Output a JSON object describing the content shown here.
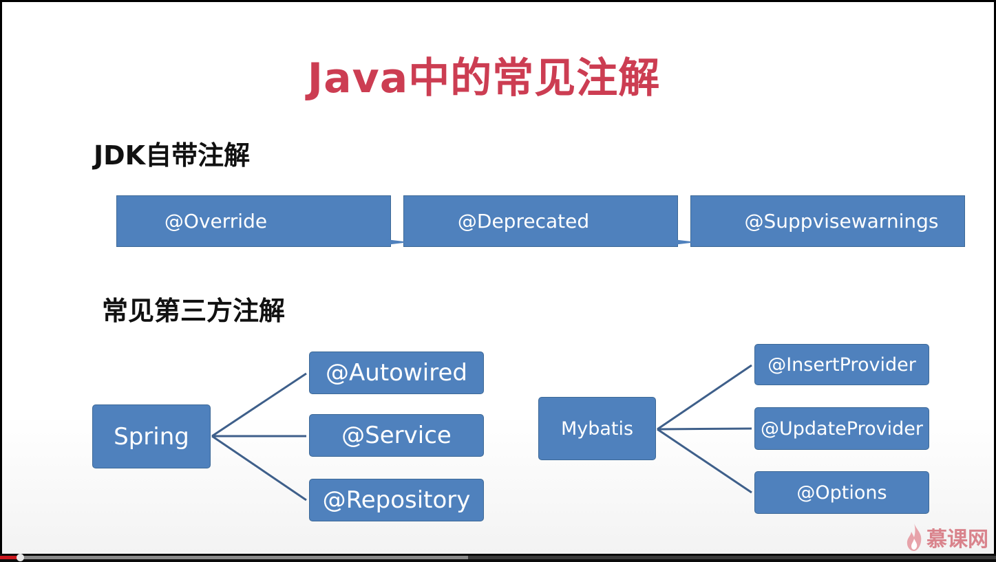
{
  "slide": {
    "title": "Java中的常见注解",
    "jdk_section_title": "JDK自带注解",
    "jdk_annotations": [
      "@Override",
      "@Deprecated",
      "@Suppvisewarnings"
    ],
    "third_party_section_title": "常见第三方注解",
    "spring": {
      "label": "Spring",
      "children": [
        "@Autowired",
        "@Service",
        "@Repository"
      ]
    },
    "mybatis": {
      "label": "Mybatis",
      "children": [
        "@InsertProvider",
        "@UpdateProvider",
        "@Options"
      ]
    },
    "watermark": "慕课网",
    "colors": {
      "title": "#cc3d52",
      "box_fill": "#4f81bd",
      "connector": "#3e5f8a"
    }
  },
  "player": {
    "progress_played_fraction": 0.02,
    "progress_buffered_fraction": 0.47
  }
}
